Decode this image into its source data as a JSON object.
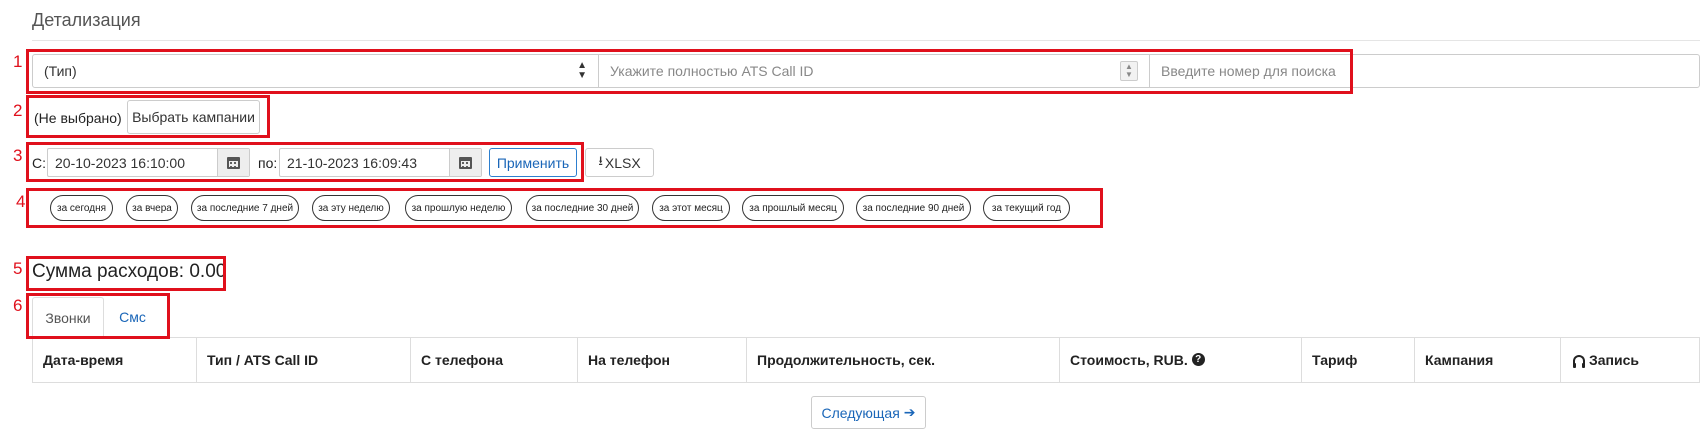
{
  "page": {
    "title": "Детализация"
  },
  "filters": {
    "type_select": {
      "value": "(Тип)"
    },
    "call_id": {
      "placeholder": "Укажите полностью ATS Call ID"
    },
    "number_search": {
      "placeholder": "Введите номер для поиска"
    }
  },
  "campaigns": {
    "selected": "(Не выбрано)",
    "button_label": "Выбрать кампании"
  },
  "date_range": {
    "from_label": "С:",
    "from_value": "20-10-2023 16:10:00",
    "to_label": "по:",
    "to_value": "21-10-2023 16:09:43",
    "apply_label": "Применить",
    "export_label": "XLSX"
  },
  "quick_periods": [
    "за сегодня",
    "за вчера",
    "за последние 7 дней",
    "за эту неделю",
    "за прошлую неделю",
    "за последние 30 дней",
    "за этот месяц",
    "за прошлый месяц",
    "за последние 90 дней",
    "за текущий год"
  ],
  "summary": {
    "text": "Сумма расходов: 0.00"
  },
  "tabs": [
    {
      "label": "Звонки",
      "active": true
    },
    {
      "label": "Смс",
      "active": false
    }
  ],
  "table": {
    "columns": [
      "Дата-время",
      "Тип / ATS Call ID",
      "С телефона",
      "На телефон",
      "Продолжительность, сек.",
      "Стоимость, RUB.",
      "Тариф",
      "Кампания",
      "Запись"
    ]
  },
  "pagination": {
    "next_label": "Следующая"
  },
  "annotations": [
    "1",
    "2",
    "3",
    "4",
    "5",
    "6"
  ],
  "colors": {
    "annotation": "#e0101c",
    "link": "#1a66b8"
  },
  "icons": {
    "calendar": "calendar-icon",
    "download": "download-icon",
    "help": "question-circle-icon",
    "headphones": "headphones-icon",
    "next": "arrow-right-icon"
  }
}
